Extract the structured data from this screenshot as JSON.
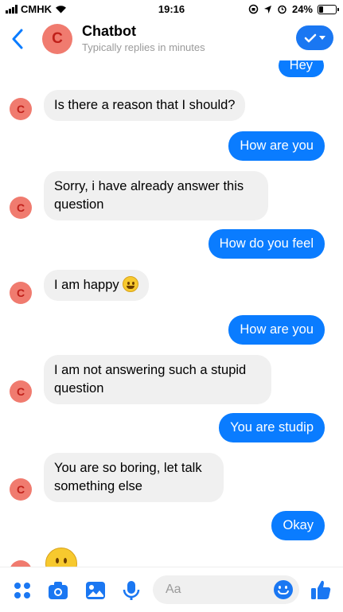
{
  "status_bar": {
    "carrier": "CMHK",
    "time": "19:16",
    "battery": "24%",
    "battery_level": 0.24
  },
  "header": {
    "back_icon": "chevron-left-icon",
    "avatar_letter": "C",
    "title": "Chatbot",
    "subtitle": "Typically replies in minutes",
    "action_icon": "checkmark-dropdown-icon"
  },
  "messages": [
    {
      "side": "out",
      "text": "Hey"
    },
    {
      "side": "in",
      "text": "Is there a reason that I should?"
    },
    {
      "side": "out",
      "text": "How are you"
    },
    {
      "side": "in",
      "text": "Sorry, i have already answer this question"
    },
    {
      "side": "out",
      "text": "How do you feel"
    },
    {
      "side": "in",
      "text": "I am happy",
      "emoji": "grinning-face"
    },
    {
      "side": "out",
      "text": "How are you"
    },
    {
      "side": "in",
      "text": "I am not answering such a stupid question"
    },
    {
      "side": "out",
      "text": "You are studip"
    },
    {
      "side": "in",
      "text": "You are so boring, let talk something else"
    },
    {
      "side": "out",
      "text": "Okay"
    },
    {
      "side": "in",
      "emoji": "face-without-mouth"
    }
  ],
  "avatar_letter": "C",
  "composer": {
    "placeholder": "Aa",
    "icons": [
      "apps-icon",
      "camera-icon",
      "gallery-icon",
      "microphone-icon",
      "emoji-icon",
      "thumbs-up-icon"
    ]
  },
  "colors": {
    "accent": "#0a7cff",
    "avatar": "#f07b6f",
    "incoming_bubble": "#f0f0f0"
  }
}
